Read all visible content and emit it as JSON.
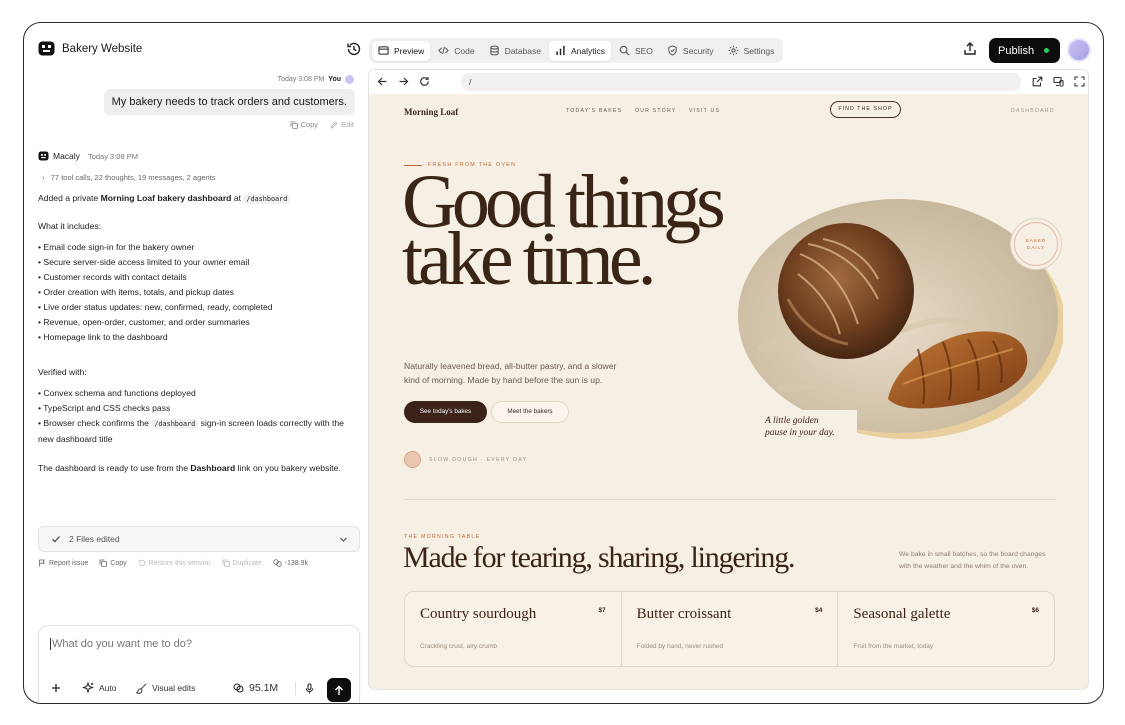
{
  "app": {
    "title": "Bakery Website",
    "publish_label": "Publish"
  },
  "tabs": [
    {
      "label": "Preview"
    },
    {
      "label": "Code"
    },
    {
      "label": "Database"
    },
    {
      "label": "Analytics"
    },
    {
      "label": "SEO"
    },
    {
      "label": "Security"
    },
    {
      "label": "Settings"
    }
  ],
  "chat": {
    "user_time": "Today 3:08 PM",
    "user_name": "You",
    "user_message": "My bakery needs to track orders and customers.",
    "copy_label": "Copy",
    "edit_label": "Edit",
    "agent_name": "Macaly",
    "agent_time": "Today 3:08 PM",
    "tool_summary": "77 tool calls, 22 thoughts, 19 messages, 2 agents",
    "intro_prefix": "Added a private ",
    "intro_bold": "Morning Loaf bakery dashboard",
    "intro_mid": " at ",
    "intro_code": "/dashboard",
    "includes_heading": "What it includes:",
    "includes": [
      "• Email code sign-in for the bakery owner",
      "• Secure server-side access limited to your owner email",
      "• Customer records with contact details",
      "• Order creation with items, totals, and pickup dates",
      "• Live order status updates: new, confirmed, ready, completed",
      "• Revenue, open-order, customer, and order summaries",
      "• Homepage link to the dashboard"
    ],
    "verified_heading": "Verified with:",
    "verified_1": "• Convex schema and functions deployed",
    "verified_2": "• TypeScript and CSS checks pass",
    "verified_3_prefix": "• Browser check confirms the ",
    "verified_3_code": "/dashboard",
    "verified_3_suffix": " sign-in screen loads correctly with the new dashboard title",
    "closing_prefix": "The dashboard is ready to use from the ",
    "closing_bold": "Dashboard",
    "closing_suffix": " link on you bakery website.",
    "files_edited": "2 Files edited",
    "report_issue": "Report issue",
    "copy2": "Copy",
    "restore": "Restore this version",
    "duplicate": "Duplicate",
    "token_delta": "-138.9k"
  },
  "composer": {
    "placeholder": "What do you want me to do?",
    "auto_label": "Auto",
    "visual_edits_label": "Visual edits",
    "credits": "95.1M"
  },
  "browser": {
    "url": "/"
  },
  "site": {
    "logo": "Morning Loaf",
    "nav": [
      "TODAY'S BAKES",
      "OUR STORY",
      "VISIT US"
    ],
    "cta": "FIND THE SHOP",
    "dashboard_link": "DASHBOARD",
    "eyebrow": "FRESH FROM THE OVEN",
    "hero_title": "Good things take time.",
    "hero_sub": "Naturally leavened bread, all-butter pastry, and a slower kind of morning. Made by hand before the sun is up.",
    "btn_primary": "See today's bakes",
    "btn_secondary": "Meet the bakers",
    "badge_line1": "BAKED",
    "badge_line2": "DAILY",
    "caption_line1": "A little golden",
    "caption_line2": "pause in your day.",
    "dough_label": "SLOW DOUGH · EVERY DAY",
    "table_eyebrow": "THE MORNING TABLE",
    "table_title": "Made for tearing, sharing, lingering.",
    "table_note": "We bake in small batches, so the board changes with the weather and the whim of the oven.",
    "cards": [
      {
        "name": "Country sourdough",
        "price": "$7",
        "desc": "Crackling crust, airy crumb"
      },
      {
        "name": "Butter croissant",
        "price": "$4",
        "desc": "Folded by hand, never rushed"
      },
      {
        "name": "Seasonal galette",
        "price": "$6",
        "desc": "Fruit from the market, today"
      }
    ]
  },
  "colors": {
    "accent": "#c46a3a",
    "brand_dark": "#3a2416",
    "site_bg": "#f6efe3",
    "publish_dot": "#2bd15a"
  }
}
